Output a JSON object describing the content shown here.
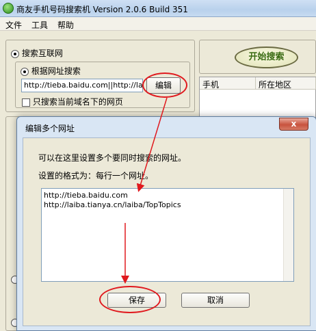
{
  "window": {
    "title": "商友手机号码搜索机 Version 2.0.6 Build 351",
    "menu": [
      "文件",
      "工具",
      "帮助"
    ]
  },
  "search_panel": {
    "internet_search_label": "搜索互联网",
    "by_url_label": "根据网址搜索",
    "url_value": "http://tieba.baidu.com||http://laiba",
    "edit_button": "编辑",
    "same_domain_label": "只搜索当前域名下的网页",
    "start_button": "开始搜索"
  },
  "results": {
    "columns": [
      "手机",
      "所在地区"
    ]
  },
  "dialog": {
    "title": "编辑多个网址",
    "close_label": "x",
    "instruction": "可以在这里设置多个要同时搜索的网址。",
    "format_hint": "设置的格式为：每行一个网址。",
    "urls": [
      "http://tieba.baidu.com",
      "http://laiba.tianya.cn/laiba/TopTopics"
    ],
    "save_button": "保存",
    "cancel_button": "取消"
  },
  "colors": {
    "annotation_red": "#e0191e",
    "start_text": "#3a6b12"
  }
}
